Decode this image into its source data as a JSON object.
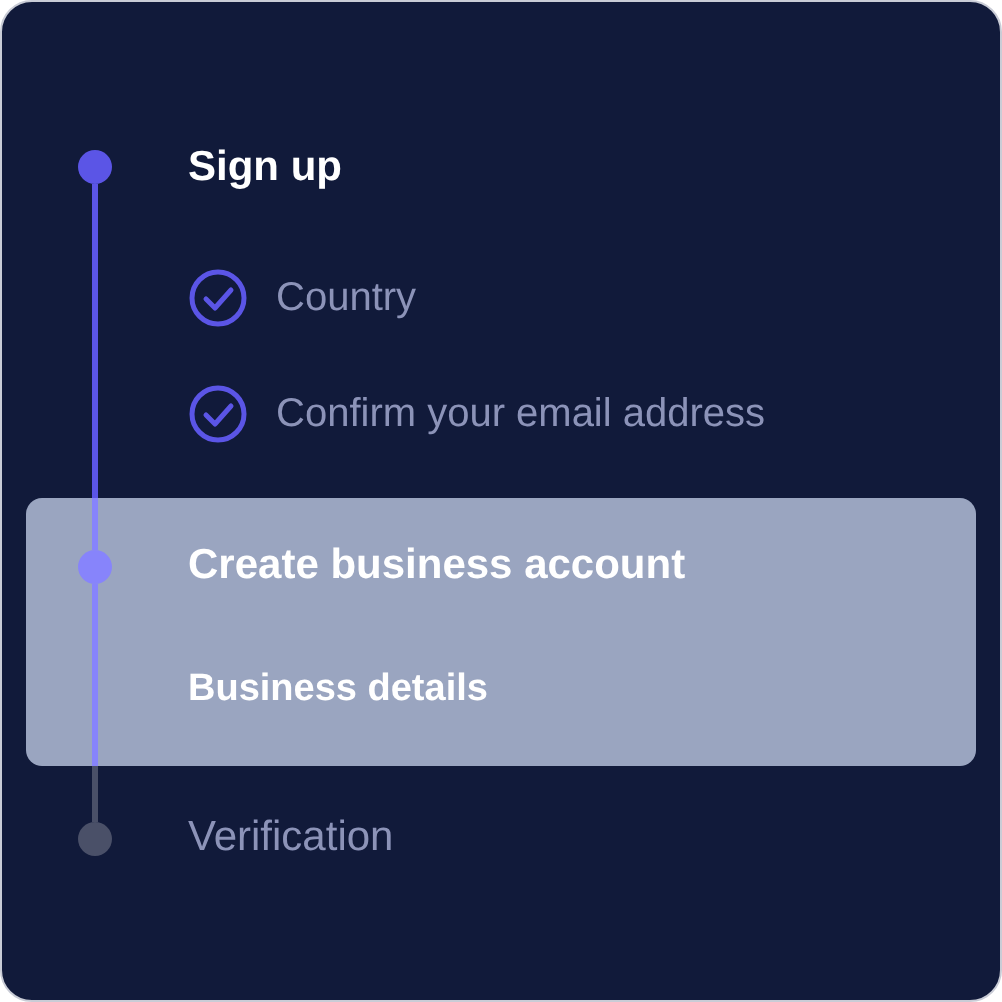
{
  "steps": [
    {
      "title": "Sign up",
      "kind": "done",
      "selected": false,
      "substeps": [
        {
          "label": "Country",
          "kind": "done"
        },
        {
          "label": "Confirm your email address",
          "kind": "done"
        }
      ]
    },
    {
      "title": "Create business account",
      "kind": "current",
      "selected": true,
      "substeps": [
        {
          "label": "Business details",
          "kind": "current"
        }
      ]
    },
    {
      "title": "Verification",
      "kind": "upcoming",
      "selected": false
    }
  ]
}
